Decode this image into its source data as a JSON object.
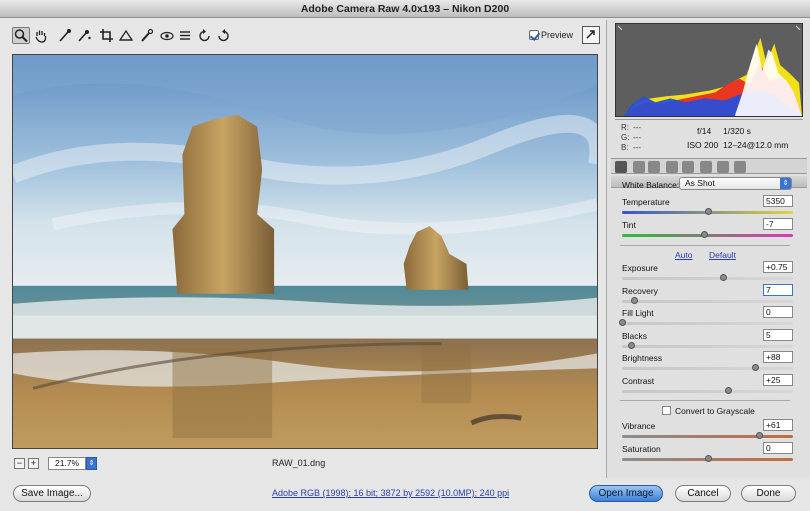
{
  "window": {
    "title": "Adobe Camera Raw 4.0x193  –  Nikon D200"
  },
  "toolbar": {
    "tools": [
      "zoom-tool",
      "hand-tool",
      "white-balance-tool",
      "color-sampler-tool",
      "crop-tool",
      "straighten-tool",
      "retouch-tool",
      "red-eye-tool",
      "preferences",
      "rotate-left",
      "rotate-right"
    ],
    "preview_label": "Preview",
    "preview_checked": true
  },
  "image": {
    "filename": "RAW_01.dng"
  },
  "zoom": {
    "level": "21.7%"
  },
  "histogram": {
    "colors": [
      "#2b4fd6",
      "#e82b22",
      "#f2e019",
      "#ffffff"
    ]
  },
  "readout": {
    "r_label": "R:",
    "g_label": "G:",
    "b_label": "B:",
    "r_value": "---",
    "g_value": "---",
    "b_value": "---",
    "aperture": "f/14",
    "shutter": "1/320 s",
    "iso": "ISO 200",
    "lens": "12–24@12.0 mm"
  },
  "panel": {
    "title": "Basic",
    "white_balance": {
      "label": "White Balance:",
      "value": "As Shot"
    },
    "auto_label": "Auto",
    "default_label": "Default",
    "grayscale_label": "Convert to Grayscale",
    "params": {
      "temperature": {
        "label": "Temperature",
        "value": "5350",
        "pos": 0.5
      },
      "tint": {
        "label": "Tint",
        "value": "-7",
        "pos": 0.48
      },
      "exposure": {
        "label": "Exposure",
        "value": "+0.75",
        "pos": 0.59
      },
      "recovery": {
        "label": "Recovery",
        "value": "7",
        "pos": 0.07
      },
      "fill_light": {
        "label": "Fill Light",
        "value": "0",
        "pos": 0.0
      },
      "blacks": {
        "label": "Blacks",
        "value": "5",
        "pos": 0.05
      },
      "brightness": {
        "label": "Brightness",
        "value": "+88",
        "pos": 0.78
      },
      "contrast": {
        "label": "Contrast",
        "value": "+25",
        "pos": 0.62
      },
      "vibrance": {
        "label": "Vibrance",
        "value": "+61",
        "pos": 0.8
      },
      "saturation": {
        "label": "Saturation",
        "value": "0",
        "pos": 0.5
      }
    }
  },
  "footer": {
    "save_label": "Save Image...",
    "workflow": "Adobe RGB (1998); 16 bit; 3872 by 2592 (10.0MP); 240 ppi",
    "open_label": "Open Image",
    "cancel_label": "Cancel",
    "done_label": "Done"
  }
}
